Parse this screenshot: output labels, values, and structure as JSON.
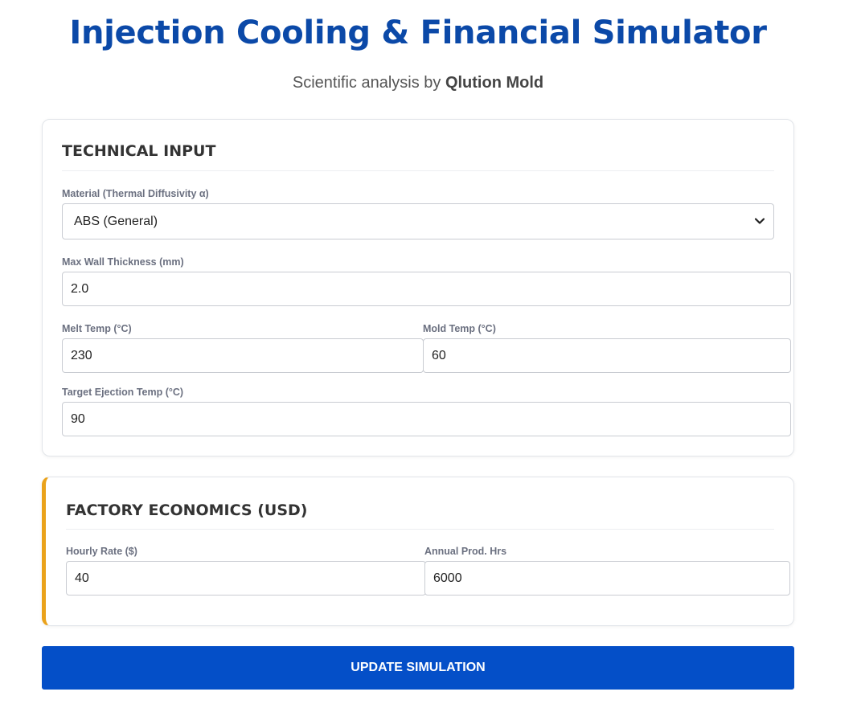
{
  "header": {
    "title": "Injection Cooling & Financial Simulator",
    "subtitle_prefix": "Scientific analysis by ",
    "subtitle_brand": "Qlution Mold"
  },
  "technical": {
    "heading": "TECHNICAL INPUT",
    "material": {
      "label": "Material (Thermal Diffusivity α)",
      "value": "ABS (General)"
    },
    "wall": {
      "label": "Max Wall Thickness (mm)",
      "value": "2.0"
    },
    "melt": {
      "label": "Melt Temp (°C)",
      "value": "230"
    },
    "mold": {
      "label": "Mold Temp (°C)",
      "value": "60"
    },
    "eject": {
      "label": "Target Ejection Temp (°C)",
      "value": "90"
    }
  },
  "economics": {
    "heading": "FACTORY ECONOMICS (USD)",
    "hourly": {
      "label": "Hourly Rate ($)",
      "value": "40"
    },
    "annual": {
      "label": "Annual Prod. Hrs",
      "value": "6000"
    }
  },
  "actions": {
    "update_label": "UPDATE SIMULATION"
  },
  "colors": {
    "title": "#0b49a8",
    "button": "#044fc8",
    "econ_accent": "#eaa21b"
  }
}
